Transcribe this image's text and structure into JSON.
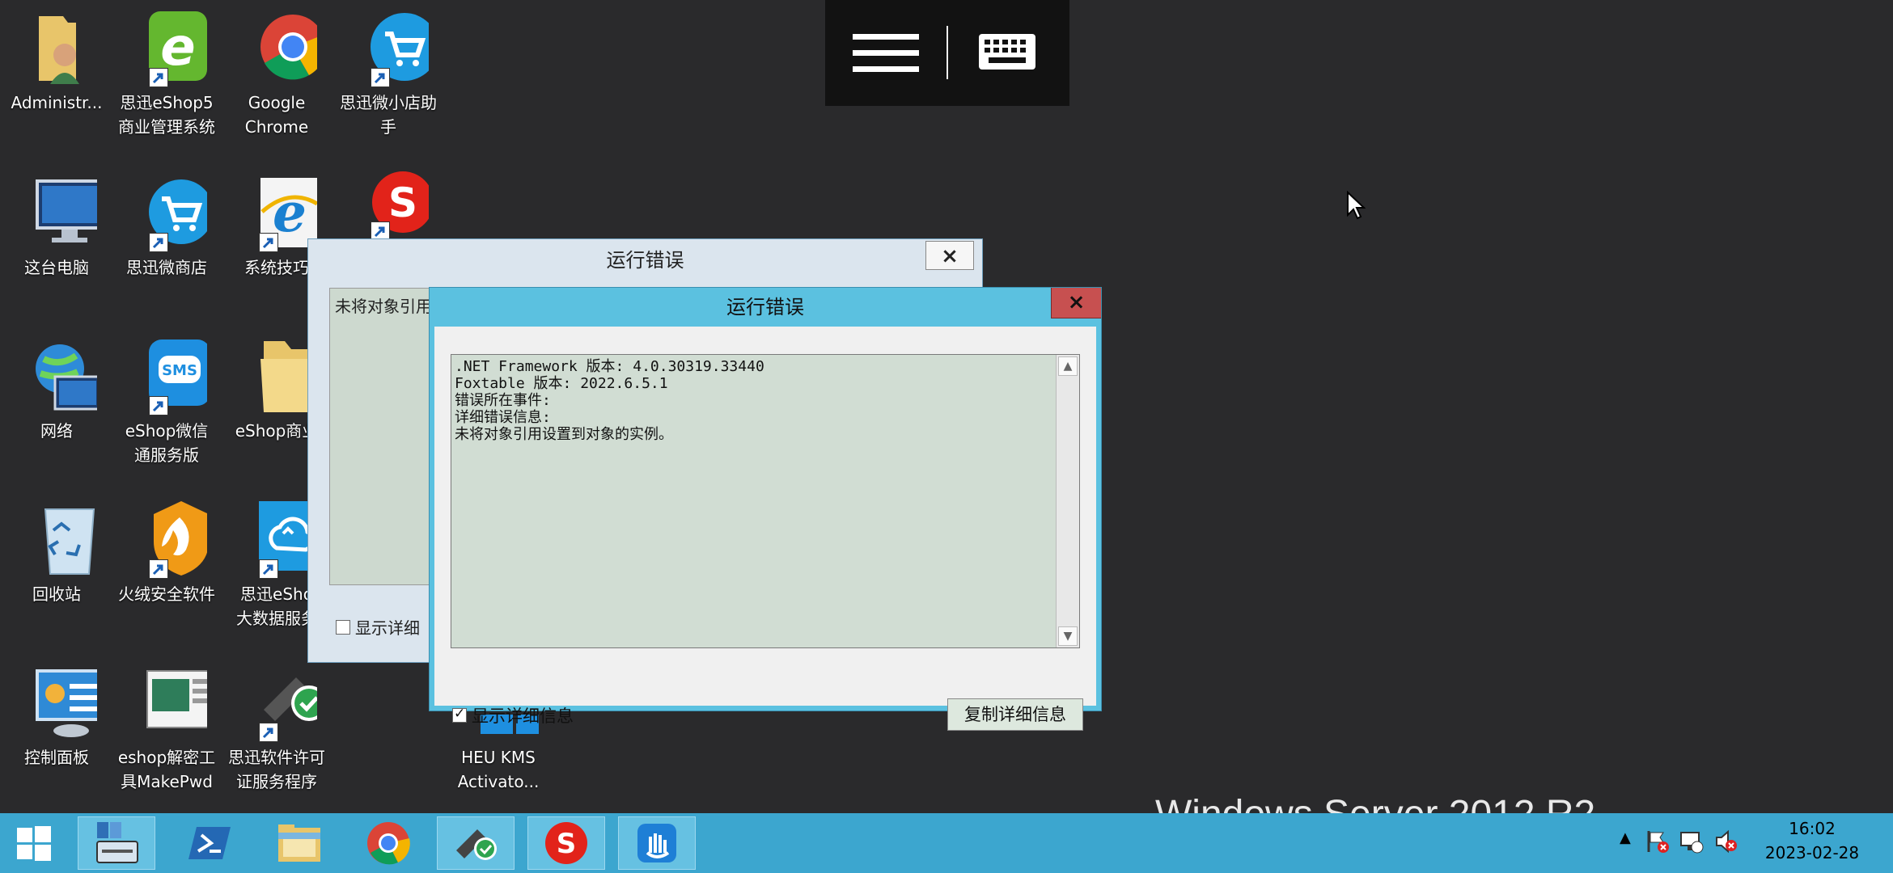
{
  "desktop_icons": [
    {
      "label": "Administr...",
      "icon": "user-folder-icon"
    },
    {
      "label": "思迅eShop5\n商业管理系统",
      "icon": "eshop-e-icon"
    },
    {
      "label": "Google\nChrome",
      "icon": "chrome-icon"
    },
    {
      "label": "思迅微小店助\n手",
      "icon": "cart-icon"
    },
    {
      "label": "这台电脑",
      "icon": "computer-icon"
    },
    {
      "label": "思迅微商店",
      "icon": "cart-icon"
    },
    {
      "label": "系统技巧",
      "icon": "ie-icon"
    },
    {
      "label": "",
      "icon": "red-s-icon"
    },
    {
      "label": "网络",
      "icon": "network-icon"
    },
    {
      "label": "eShop微信\n通服务版",
      "icon": "sms-icon"
    },
    {
      "label": "eShop商业",
      "icon": "folder-icon"
    },
    {
      "label": "回收站",
      "icon": "recycle-bin-icon"
    },
    {
      "label": "火绒安全软件",
      "icon": "huorong-icon"
    },
    {
      "label": "思迅eSho\n大数据服务",
      "icon": "cloud-icon"
    },
    {
      "label": "控制面板",
      "icon": "control-panel-icon"
    },
    {
      "label": "eshop解密工\n具MakePwd",
      "icon": "makepwd-icon"
    },
    {
      "label": "思迅软件许可\n证服务程序",
      "icon": "license-icon"
    },
    {
      "label": "HEU KMS\nActivato...",
      "icon": "kms-icon"
    }
  ],
  "dialog_back": {
    "title": "运行错误",
    "close": "×",
    "text": "未将对象引用",
    "checkbox_label": "显示详细"
  },
  "dialog_front": {
    "title": "运行错误",
    "close": "×",
    "detail_lines": ".NET Framework 版本: 4.0.30319.33440\nFoxtable 版本: 2022.6.5.1\n错误所在事件:\n详细错误信息:\n未将对象引用设置到对象的实例。",
    "checkbox_label": "显示详细信息",
    "checkbox_checked": true,
    "copy_button": "复制详细信息"
  },
  "watermark": "Windows Server 2012 R2",
  "clock": {
    "time": "16:02",
    "date": "2023-02-28"
  },
  "colors": {
    "taskbar": "#3ca6cf",
    "desktop": "#2a2a2c",
    "dialog_title_active": "#5bc1e0",
    "close_red": "#c75050"
  }
}
